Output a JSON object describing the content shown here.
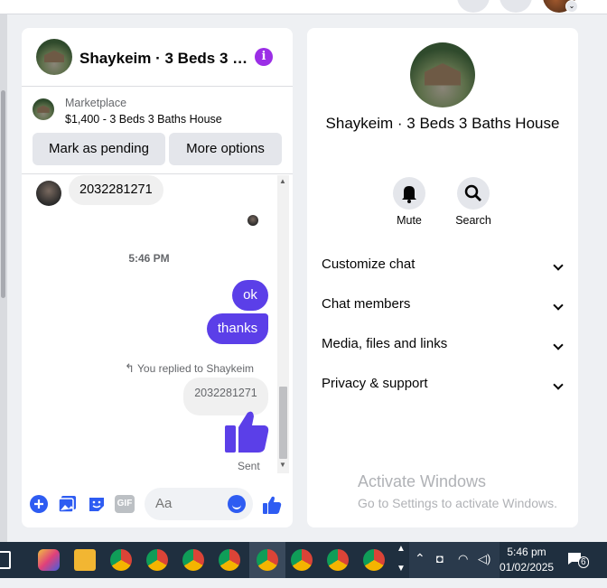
{
  "conversation": {
    "title": "Shaykeim · 3 Beds 3 …",
    "marketplace_label": "Marketplace",
    "listing": "$1,400 - 3 Beds 3 Baths House",
    "mark_pending": "Mark as pending",
    "more_options": "More options",
    "messages": {
      "incoming_phone": "2032281271",
      "timestamp": "5:46 PM",
      "out_1": "ok",
      "out_2": "thanks",
      "replied_to": "You replied to Shaykeim",
      "quoted": "2032281271",
      "status": "Sent"
    },
    "composer_placeholder": "Aa",
    "gif_label": "GIF"
  },
  "info_panel": {
    "title": "Shaykeim · 3 Beds 3 Baths House",
    "mute": "Mute",
    "search": "Search",
    "sections": [
      "Customize chat",
      "Chat members",
      "Media, files and links",
      "Privacy & support"
    ]
  },
  "watermark": {
    "line1": "Activate Windows",
    "line2": "Go to Settings to activate Windows."
  },
  "taskbar": {
    "time": "5:46 pm",
    "date": "01/02/2025",
    "notifications": "6"
  },
  "colors": {
    "accent": "#5b3fe8",
    "messenger_blue": "#2e5cf2",
    "info_purple": "#9b2ee6"
  }
}
